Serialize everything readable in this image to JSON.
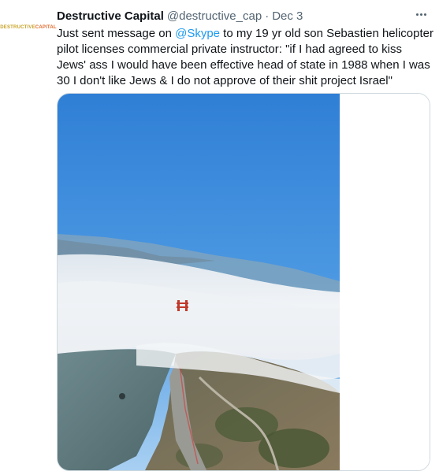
{
  "tweet": {
    "avatar_text_main": "DESTRUCTIVE",
    "avatar_text_accent": "CAPITAL",
    "author_name": "Destructive Capital",
    "author_handle": "@destructive_cap",
    "separator": "·",
    "date": "Dec 3",
    "text_before_mention": "Just sent message on ",
    "mention": "@Skype",
    "text_after_mention": " to my 19 yr old son Sebastien helicopter pilot licenses commercial private instructor: \"if I had agreed to kiss Jews' ass I would have been effective head of state in 1988 when I was 30 I don't like Jews & I do not approve of their shit project Israel\"",
    "more_icon": "more-horizontal-icon",
    "media_description_icon": "photo"
  },
  "colors": {
    "link": "#1d9bf0",
    "secondary_text": "#536471",
    "border": "#cfd9de",
    "sky_top": "#2f7fd6",
    "sky_bottom": "#9fc8ef",
    "fog": "#e9eef3",
    "bridge": "#c0392b"
  }
}
